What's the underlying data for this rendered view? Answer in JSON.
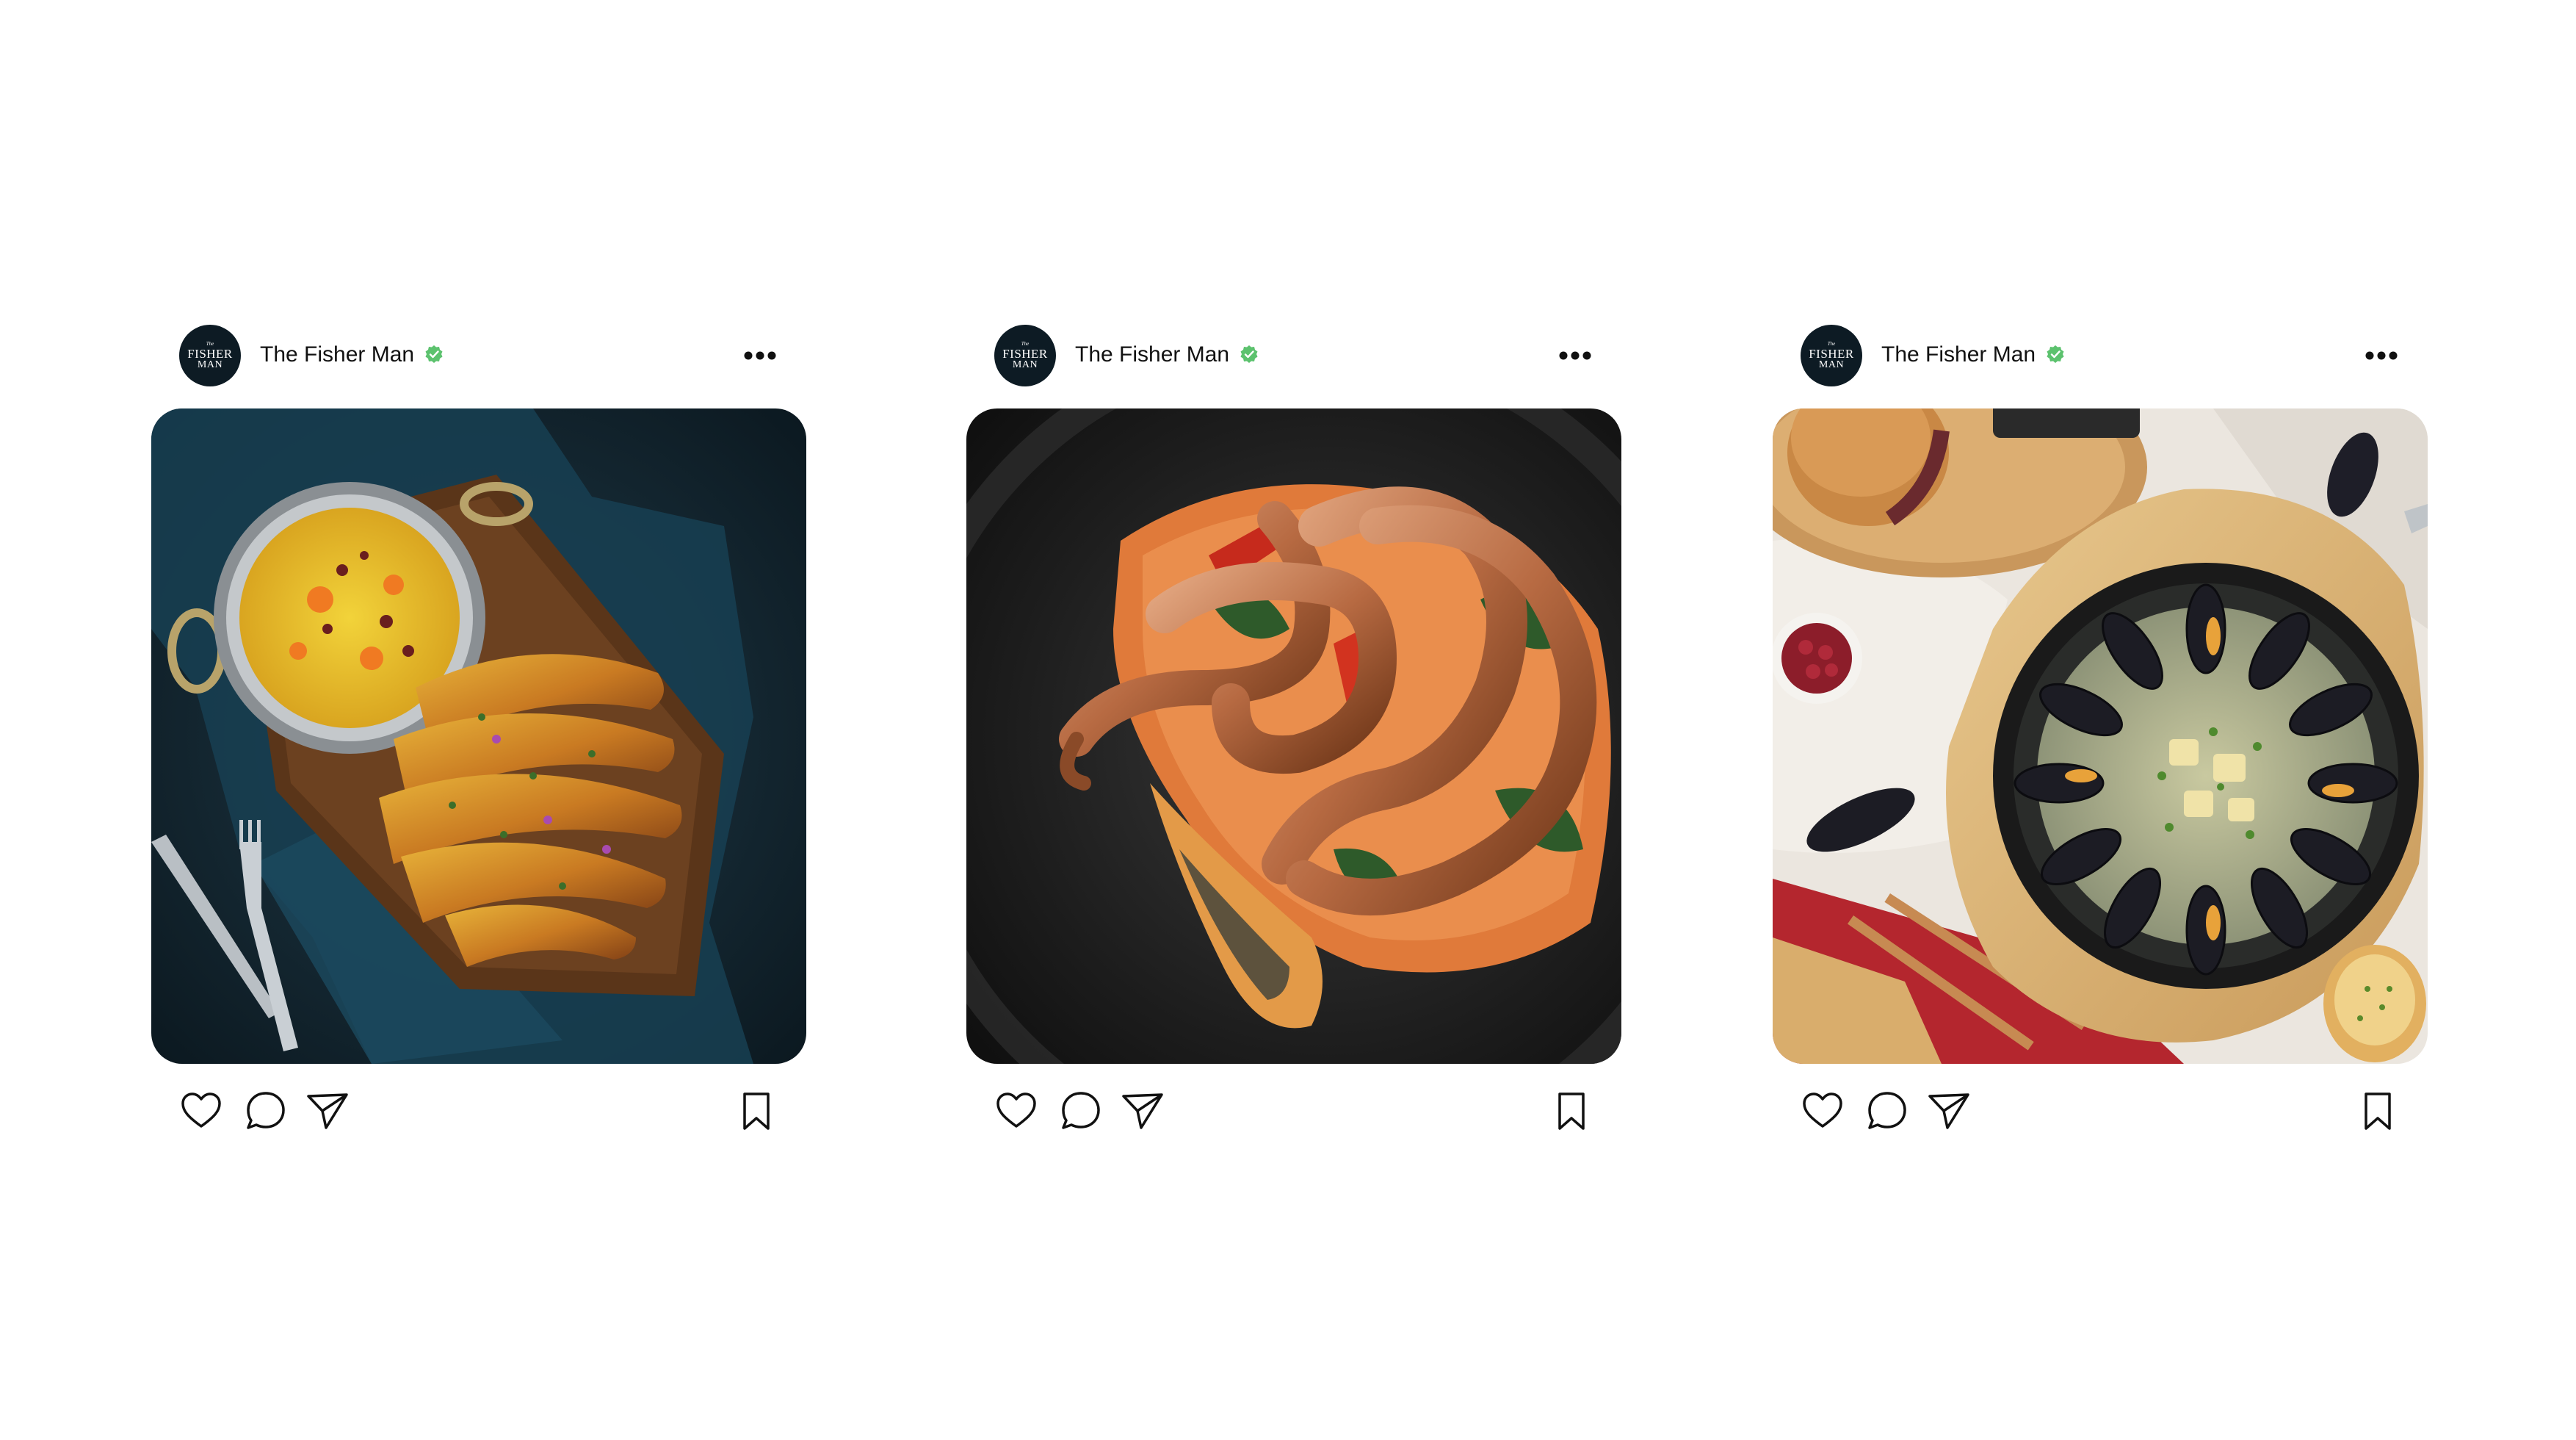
{
  "page": {
    "background": "#ffffff"
  },
  "brand": {
    "avatar_logo_text_top": "The",
    "avatar_logo_text_main": "FISHER",
    "avatar_logo_text_sub": "MAN",
    "avatar_color": "#0d1b24",
    "verified_color": "#5cc26e"
  },
  "posts": [
    {
      "username": "The Fisher Man",
      "verified": true,
      "more_icon": "more-horizontal-icon",
      "image_subject": "grilled-prawns-with-saffron-rice",
      "actions": {
        "like_icon": "heart-icon",
        "comment_icon": "comment-icon",
        "share_icon": "send-icon",
        "save_icon": "bookmark-icon"
      }
    },
    {
      "username": "The Fisher Man",
      "verified": true,
      "more_icon": "more-horizontal-icon",
      "image_subject": "grilled-octopus-on-puree",
      "actions": {
        "like_icon": "heart-icon",
        "comment_icon": "comment-icon",
        "share_icon": "send-icon",
        "save_icon": "bookmark-icon"
      }
    },
    {
      "username": "The Fisher Man",
      "verified": true,
      "more_icon": "more-horizontal-icon",
      "image_subject": "mussels-pan-and-burger",
      "actions": {
        "like_icon": "heart-icon",
        "comment_icon": "comment-icon",
        "share_icon": "send-icon",
        "save_icon": "bookmark-icon"
      }
    }
  ]
}
